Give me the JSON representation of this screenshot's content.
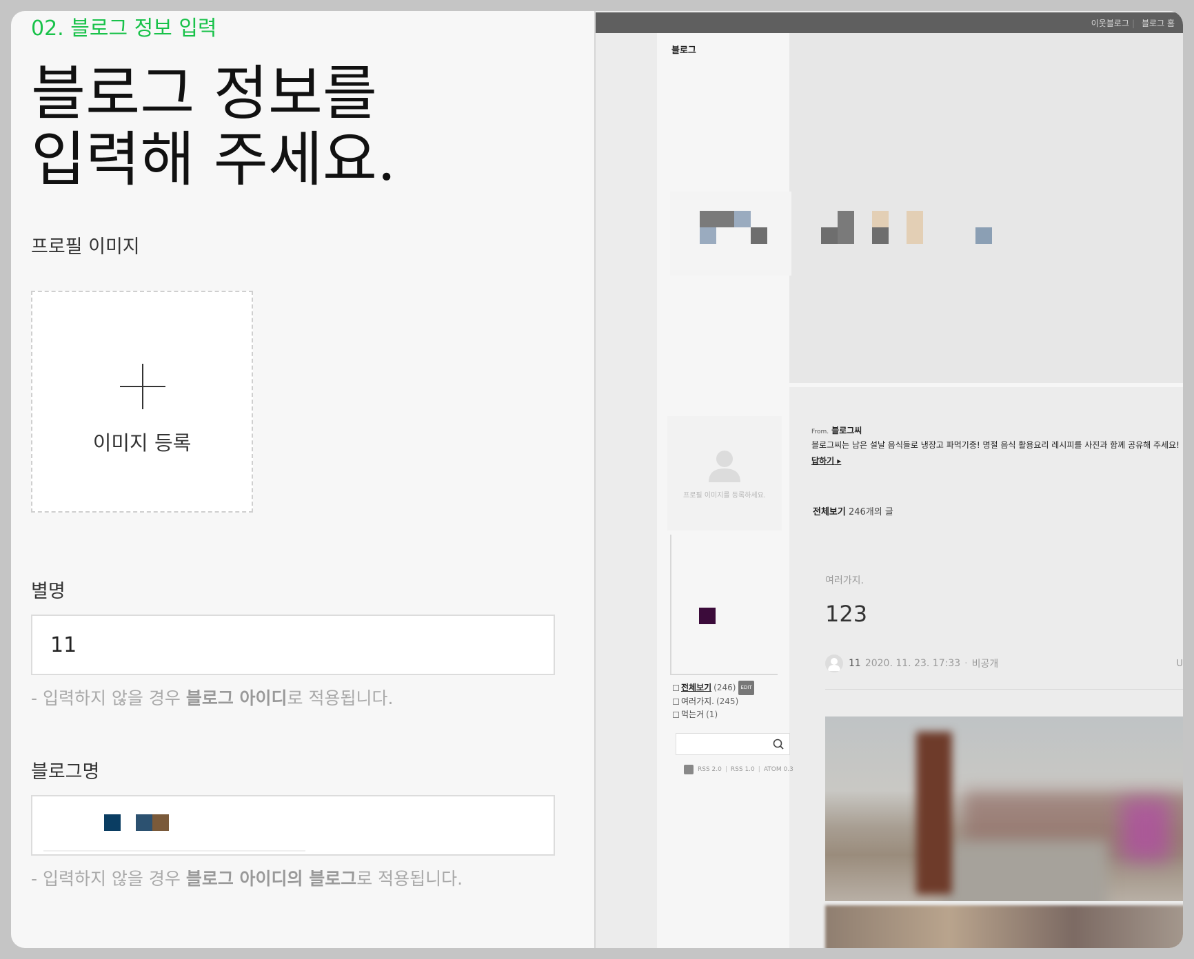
{
  "form": {
    "step": "02. 블로그 정보 입력",
    "headline_line1": "블로그 정보를",
    "headline_line2": "입력해 주세요.",
    "profile_label": "프로필 이미지",
    "upload_label": "이미지 등록",
    "nickname_label": "별명",
    "nickname_value": "11",
    "nickname_hint_prefix": "- 입력하지 않을 경우 ",
    "nickname_hint_bold": "블로그 아이디",
    "nickname_hint_suffix": "로 적용됩니다.",
    "blogname_label": "블로그명",
    "blogname_value": "",
    "blogname_hint_prefix": "- 입력하지 않을 경우 ",
    "blogname_hint_bold": "블로그 아이디의 블로그",
    "blogname_hint_suffix": "로 적용됩니다."
  },
  "preview": {
    "topbar_links": [
      "이웃블로그",
      "블로그 홈"
    ],
    "blog_title": "블로그",
    "profile_placeholder": "프로필 이미지를 등록하세요.",
    "categories": [
      {
        "name": "전체보기",
        "count": "(246)",
        "badge": "EDIT"
      },
      {
        "name": "여러가지.",
        "count": "(245)"
      },
      {
        "name": "먹는거",
        "count": "(1)"
      }
    ],
    "feeds": [
      "RSS 2.0",
      "RSS 1.0",
      "ATOM 0.3"
    ],
    "from_prefix": "From.",
    "from_name": "블로그씨",
    "greeting": "블로그씨는 남은 설날 음식들로 냉장고 파먹기중! 명절 음식 활용요리 레시피를 사진과 함께 공유해 주세요!",
    "reply": "답하기",
    "allview_label": "전체보기",
    "allview_count": "246개의 글",
    "post_category": "여러가지.",
    "post_title": "123",
    "post_author": "11",
    "post_date": "2020. 11. 23. 17:33",
    "post_visibility": "비공개",
    "url_label": "UR"
  },
  "colors": {
    "accent_green": "#19c24a",
    "topbar": "#5f5f5f"
  }
}
